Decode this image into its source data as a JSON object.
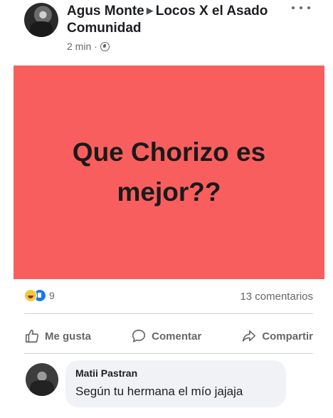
{
  "post": {
    "author": "Agus Monte",
    "group": "Locos X el Asado Comunidad",
    "time": "2 min",
    "separator": "·",
    "image_text": "Que Chorizo es mejor??",
    "image_color": "#f95e5e"
  },
  "reactions": {
    "icons": [
      "haha-icon",
      "like-icon"
    ],
    "count": "9",
    "comments": "13 comentarios"
  },
  "actions": {
    "like": "Me gusta",
    "comment": "Comentar",
    "share": "Compartir"
  },
  "comment": {
    "author": "Matii Pastran",
    "text": "Según tu hermana el mío jajaja"
  }
}
